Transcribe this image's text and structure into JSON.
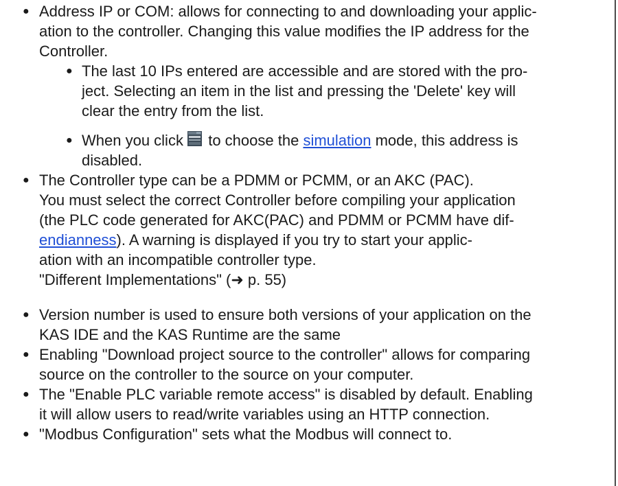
{
  "items": [
    {
      "lines": [
        "Address IP or COM: allows for connecting to and downloading your applic-",
        "ation to the controller. Changing this value modifies the IP address for the",
        "Controller."
      ],
      "sub": [
        {
          "lines": [
            "The last 10 IPs entered are accessible and are stored with the pro-",
            "ject. Selecting an item in the list and pressing the 'Delete' key will",
            "clear the entry from the list."
          ]
        },
        {
          "pre": "When you click",
          "icon": "simulation-mode-icon",
          "mid": "to choose the",
          "link": "simulation",
          "post": "mode, this address is",
          "line2": "disabled."
        }
      ]
    },
    {
      "lines": [
        "The Controller type can be a PDMM or PCMM, or an AKC (PAC).",
        "You must select the correct Controller before compiling your application",
        "(the PLC code generated for AKC(PAC) and PDMM or PCMM have dif-"
      ],
      "line4_link": "endianness",
      "line4_post": "). A warning is displayed if you try to start your applic-",
      "line5": "ation with an incompatible controller type.",
      "line6": "\"Different Implementations\" (➜ p. 55)"
    },
    {
      "lines": [
        "Version number is used to ensure both versions of your application on the",
        "KAS IDE and the KAS Runtime are the same"
      ]
    },
    {
      "lines": [
        "Enabling \"Download project source to the controller\" allows for comparing",
        "source on the controller to the source on your computer."
      ]
    },
    {
      "lines": [
        "The \"Enable PLC variable remote access\" is disabled by default. Enabling",
        "it will allow users to read/write variables using an HTTP connection."
      ]
    },
    {
      "lines": [
        "\"Modbus Configuration\" sets what the Modbus will connect to."
      ]
    }
  ],
  "colors": {
    "link": "#1f4fd6",
    "text": "#1a1a1a",
    "rule": "#4a4a4a"
  }
}
